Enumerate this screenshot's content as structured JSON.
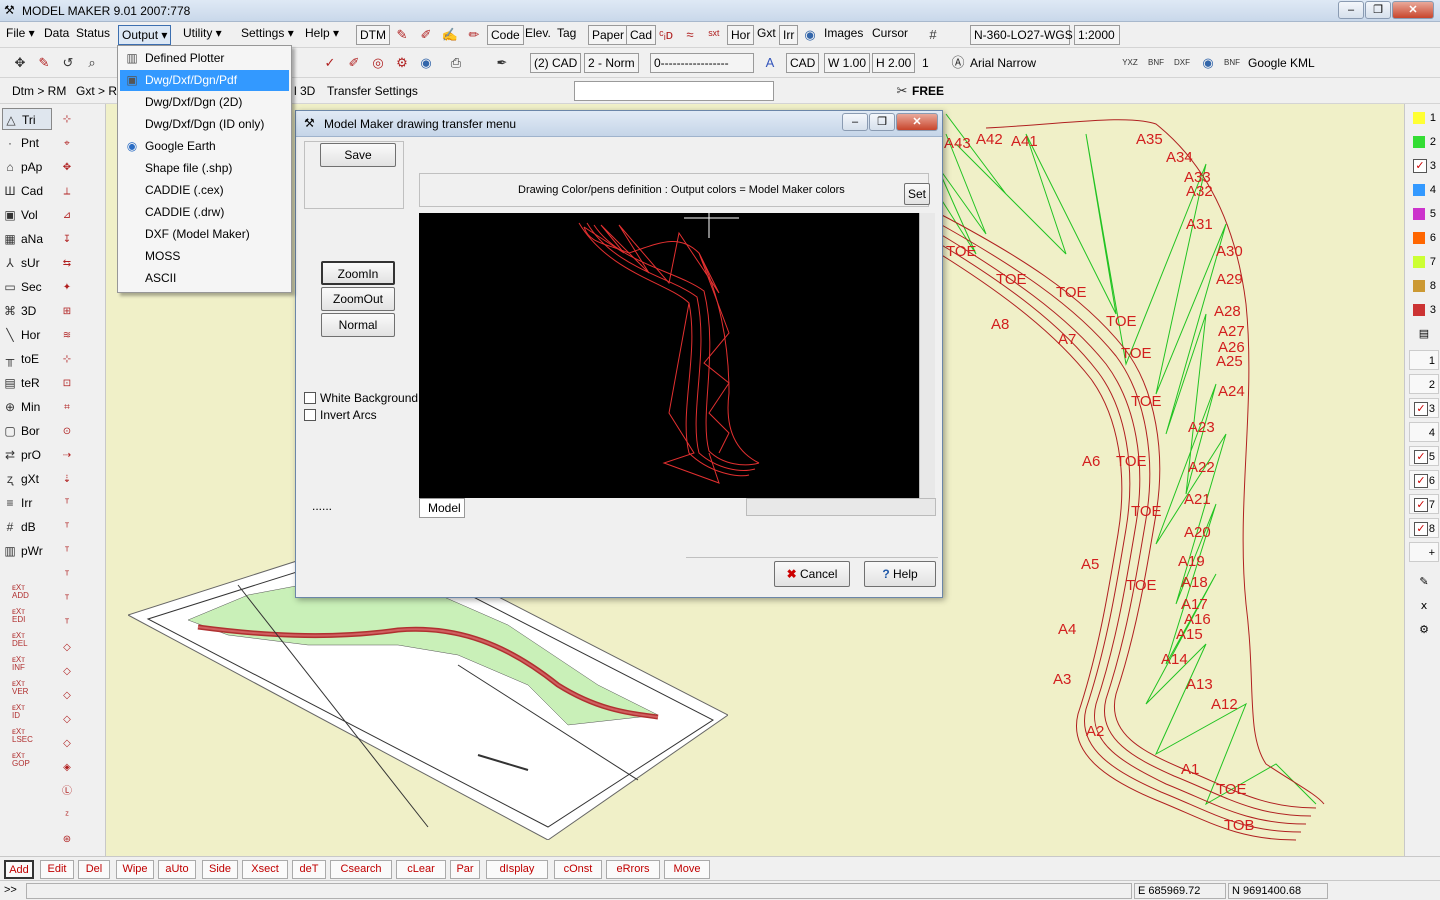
{
  "window": {
    "title": "MODEL MAKER  9.01     2007:778"
  },
  "menubar": {
    "items": [
      "File",
      "Data",
      "Status",
      "Output",
      "Utility",
      "Settings",
      "Help"
    ]
  },
  "toolbar1": {
    "dtm": "DTM",
    "code": "Code",
    "elev": "Elev.",
    "tag": "Tag",
    "paper": "Paper",
    "cad": "Cad",
    "hor": "Hor",
    "gxt": "Gxt",
    "irr": "Irr",
    "images": "Images",
    "cursor": "Cursor",
    "projection": "N-360-LO27-WGS",
    "scale": "1:2000"
  },
  "toolbar2": {
    "cad_layer": "(2) CAD",
    "pen": "2 - Norm",
    "linetype": "0-----------------",
    "cad": "CAD",
    "width": "W 1.00",
    "height": "H 2.00",
    "one": "1",
    "font": "Arial Narrow",
    "kml": "Google KML"
  },
  "toolbar3": {
    "dtm": "Dtm > RM",
    "gxt": "Gxt > RI",
    "l3d": "l 3D",
    "transfer": "Transfer Settings",
    "free": "FREE"
  },
  "output_menu": {
    "items": [
      "Defined Plotter",
      "Dwg/Dxf/Dgn/Pdf",
      "Dwg/Dxf/Dgn (2D)",
      "Dwg/Dxf/Dgn (ID only)",
      "Google Earth",
      "Shape file (.shp)",
      "CADDIE (.cex)",
      "CADDIE (.drw)",
      "DXF (Model Maker)",
      "MOSS",
      "ASCII"
    ]
  },
  "left_tools": [
    "Tri",
    "Pnt",
    "pAp",
    "Cad",
    "Vol",
    "aNa",
    "sUr",
    "Sec",
    "3D",
    "Hor",
    "toE",
    "teR",
    "Min",
    "Bor",
    "prO",
    "gXt",
    "Irr",
    "dB",
    "pWr"
  ],
  "ext_tools": [
    "ADD",
    "EDI",
    "DEL",
    "INF",
    "VER",
    "ID",
    "LSEC",
    "GOP"
  ],
  "dialog": {
    "title": "Model Maker drawing transfer menu",
    "save": "Save",
    "colors_label": "Drawing Color/pens definition : Output colors = Model Maker colors",
    "set": "Set",
    "zoomin": "ZoomIn",
    "zoomout": "ZoomOut",
    "normal": "Normal",
    "white_bg": "White Background",
    "invert_arcs": "Invert Arcs",
    "dots": "......",
    "model_tab": "Model",
    "cancel": "Cancel",
    "help": "Help"
  },
  "right_layers": [
    {
      "n": "1",
      "color": "#ffff33"
    },
    {
      "n": "2",
      "color": "#33dd33"
    },
    {
      "n": "3",
      "color": "#ff3333",
      "checked": true
    },
    {
      "n": "4",
      "color": "#3399ff"
    },
    {
      "n": "5",
      "color": "#cc33cc"
    },
    {
      "n": "6",
      "color": "#ff6600"
    },
    {
      "n": "7",
      "color": "#ccff33"
    },
    {
      "n": "8",
      "color": "#cc9933"
    },
    {
      "n": "3",
      "color": "#cc3333"
    }
  ],
  "right_nums": [
    {
      "n": "1"
    },
    {
      "n": "2"
    },
    {
      "n": "3",
      "checked": true
    },
    {
      "n": "4"
    },
    {
      "n": "5",
      "checked": true
    },
    {
      "n": "6",
      "checked": true
    },
    {
      "n": "7",
      "checked": true
    },
    {
      "n": "8",
      "checked": true
    },
    {
      "n": "+"
    }
  ],
  "bottom_buttons": [
    "Add",
    "Edit",
    "Del",
    "Wipe",
    "aUto",
    "Side",
    "Xsect",
    "deT",
    "Csearch",
    "cLear",
    "Par",
    "dIsplay",
    "cOnst",
    "eRrors",
    "Move"
  ],
  "status": {
    "prompt": ">>",
    "easting": "E 685969.72",
    "northing": "N 9691400.68"
  },
  "canvas_labels": [
    "A1",
    "A2",
    "A3",
    "A4",
    "A5",
    "A6",
    "A7",
    "A8",
    "A12",
    "A13",
    "A14",
    "A15",
    "A16",
    "A17",
    "A18",
    "A19",
    "A20",
    "A21",
    "A22",
    "A23",
    "A24",
    "A25",
    "A26",
    "A27",
    "A28",
    "A29",
    "A30",
    "A31",
    "A32",
    "A33",
    "A34",
    "A35",
    "A41",
    "A42",
    "A43",
    "TOE",
    "TOE",
    "TOE",
    "TOE",
    "TOE",
    "TOE",
    "TOE",
    "TOE",
    "TOE",
    "TOE",
    "TOB"
  ]
}
